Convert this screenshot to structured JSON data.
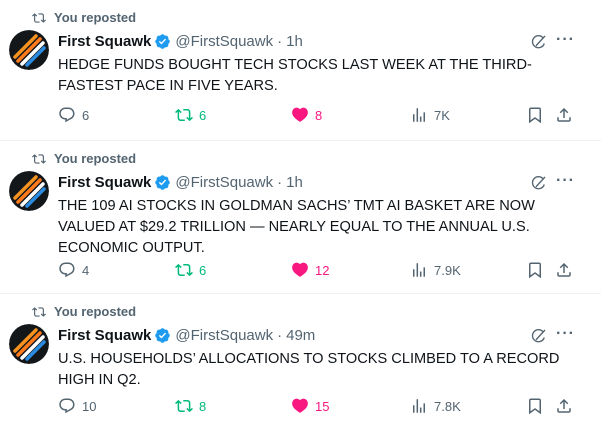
{
  "colors": {
    "repost_green": "#00ba7c",
    "like_pink": "#f91880",
    "verified_blue": "#1d9bf0",
    "muted": "#536471"
  },
  "tweets": [
    {
      "repost_label": "You reposted",
      "author_name": "First Squawk",
      "handle": "@FirstSquawk",
      "separator": "·",
      "time": "1h",
      "text": "HEDGE FUNDS BOUGHT TECH STOCKS LAST WEEK AT THE THIRD-FASTEST PACE IN FIVE YEARS.",
      "reply_count": "6",
      "repost_count": "6",
      "like_count": "8",
      "views": "7K",
      "icons": [
        "repost-icon",
        "verified-badge-icon",
        "grok-icon",
        "more-icon",
        "reply-icon",
        "like-icon",
        "views-icon",
        "bookmark-icon",
        "share-icon"
      ]
    },
    {
      "repost_label": "You reposted",
      "author_name": "First Squawk",
      "handle": "@FirstSquawk",
      "separator": "·",
      "time": "1h",
      "text": "THE 109 AI STOCKS IN GOLDMAN SACHS’ TMT AI BASKET ARE NOW VALUED AT $29.2 TRILLION — NEARLY EQUAL TO THE ANNUAL U.S. ECONOMIC OUTPUT.",
      "reply_count": "4",
      "repost_count": "6",
      "like_count": "12",
      "views": "7.9K"
    },
    {
      "repost_label": "You reposted",
      "author_name": "First Squawk",
      "handle": "@FirstSquawk",
      "separator": "·",
      "time": "49m",
      "text": "U.S. HOUSEHOLDS’ ALLOCATIONS TO STOCKS CLIMBED TO A RECORD HIGH IN Q2.",
      "reply_count": "10",
      "repost_count": "8",
      "like_count": "15",
      "views": "7.8K"
    }
  ]
}
